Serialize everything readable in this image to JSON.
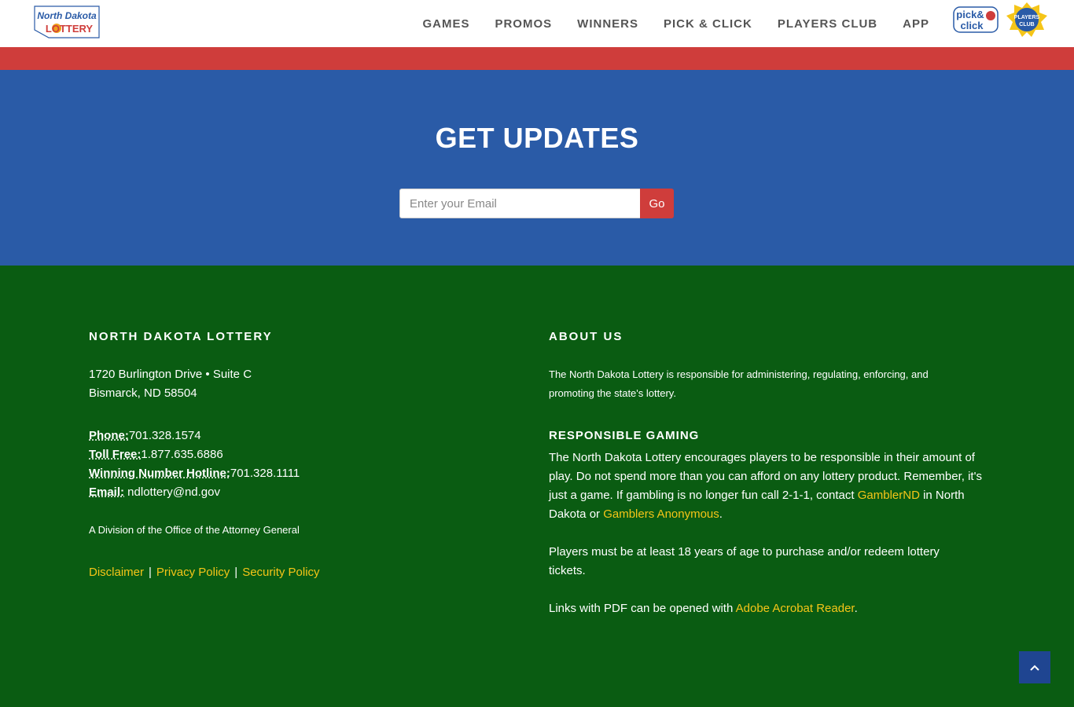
{
  "header": {
    "logo_text_top": "North Dakota",
    "logo_text_bottom": "LOTTERY",
    "nav": [
      {
        "label": "GAMES"
      },
      {
        "label": "PROMOS"
      },
      {
        "label": "WINNERS"
      },
      {
        "label": "PICK & CLICK"
      },
      {
        "label": "PLAYERS CLUB"
      },
      {
        "label": "APP"
      }
    ],
    "badge_pick_line1": "pick&",
    "badge_pick_line2": "click",
    "badge_club_line1": "PLAYERS",
    "badge_club_line2": "CLUB"
  },
  "updates": {
    "title": "GET UPDATES",
    "email_placeholder": "Enter your Email",
    "go_label": "Go"
  },
  "footer": {
    "left": {
      "heading": "NORTH DAKOTA LOTTERY",
      "address_line1": "1720 Burlington Drive • Suite C",
      "address_line2": "Bismarck, ND 58504",
      "phone_label": "Phone:",
      "phone_value": "701.328.1574",
      "tollfree_label": "Toll Free:",
      "tollfree_value": "1.877.635.6886",
      "hotline_label": "Winning Number Hotline:",
      "hotline_value": "701.328.1111",
      "email_label": "Email:",
      "email_value": " ndlottery@nd.gov",
      "division": "A Division of the Office of the Attorney General",
      "links": [
        "Disclaimer",
        "Privacy Policy",
        "Security Policy"
      ],
      "separator": "|"
    },
    "right": {
      "about_heading": "ABOUT US",
      "about_text": "The North Dakota Lottery is responsible for administering, regulating, enforcing, and promoting the state's lottery.",
      "rg_heading": "RESPONSIBLE GAMING",
      "rg_text": "The North Dakota Lottery encourages players to be responsible in their amount of play. Do not spend more than you can afford on any lottery product. Remember, it's just a game. If gambling is no longer fun call 2-1-1, contact ",
      "rg_link1": "GamblerND",
      "rg_mid": " in North Dakota or ",
      "rg_link2": "Gamblers Anonymous",
      "rg_end": ".",
      "age_text": "Players must be at least 18 years of age to purchase and/or redeem lottery tickets.",
      "pdf_text": "Links with PDF can be opened with ",
      "pdf_link": "Adobe Acrobat Reader",
      "pdf_end": "."
    }
  },
  "colors": {
    "red": "#cf3d3b",
    "blue": "#2a5ba7",
    "green": "#0a5c12",
    "link": "#f5c518"
  },
  "icons": {
    "scroll_top": "chevron-up-icon"
  }
}
